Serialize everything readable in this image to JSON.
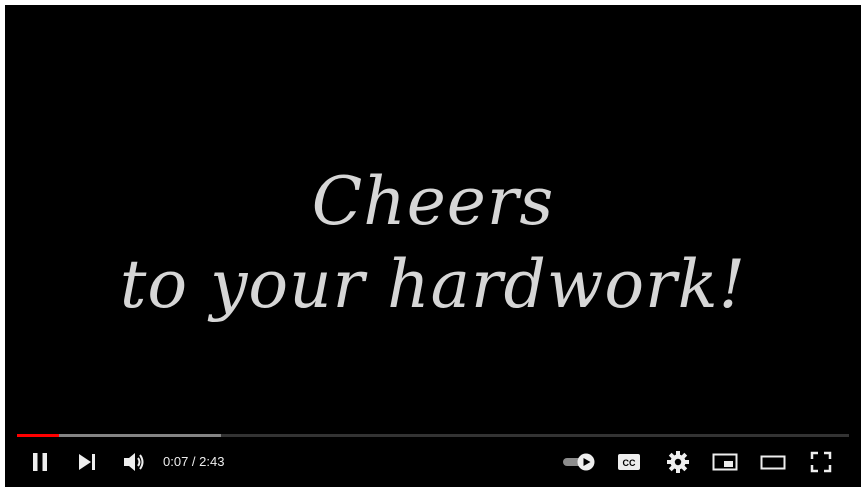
{
  "video": {
    "line1": "Cheers",
    "line2": "to your hardwork!"
  },
  "player": {
    "time_current": "0:07",
    "time_separator": " / ",
    "time_duration": "2:43",
    "progress_played_fraction": 0.05,
    "progress_buffered_fraction": 0.245
  },
  "colors": {
    "accent": "#ff0000",
    "background": "#000000",
    "controls": "#eeeeee"
  },
  "icons": {
    "pause": "pause-icon",
    "next": "next-icon",
    "volume": "volume-icon",
    "autoplay": "autoplay-toggle-icon",
    "captions": "captions-icon",
    "settings": "gear-icon",
    "miniplayer": "miniplayer-icon",
    "theater": "theater-mode-icon",
    "fullscreen": "fullscreen-icon"
  }
}
